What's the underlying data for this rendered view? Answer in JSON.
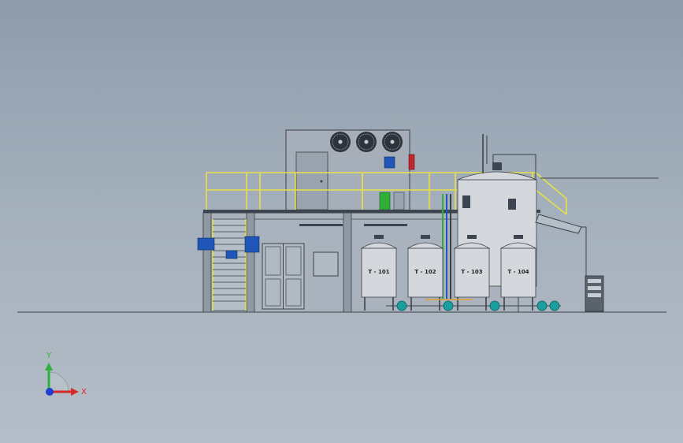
{
  "colors": {
    "railing": "#e8e04a",
    "structure": "#3d4650",
    "wall": "#a9b2bc",
    "tank": "#d4d7dc",
    "pump": "#1b9e9e",
    "accent_blue": "#1f56b8",
    "accent_red": "#c0272d",
    "accent_green": "#2fae3a",
    "axis_x": "#d42a2a",
    "axis_y": "#2fb040",
    "axis_z": "#1e3fd0"
  },
  "tanks": [
    {
      "label": "T - 101"
    },
    {
      "label": "T - 102"
    },
    {
      "label": "T - 103"
    },
    {
      "label": "T - 104"
    }
  ],
  "triad": {
    "x_label": "X",
    "y_label": "Y"
  }
}
